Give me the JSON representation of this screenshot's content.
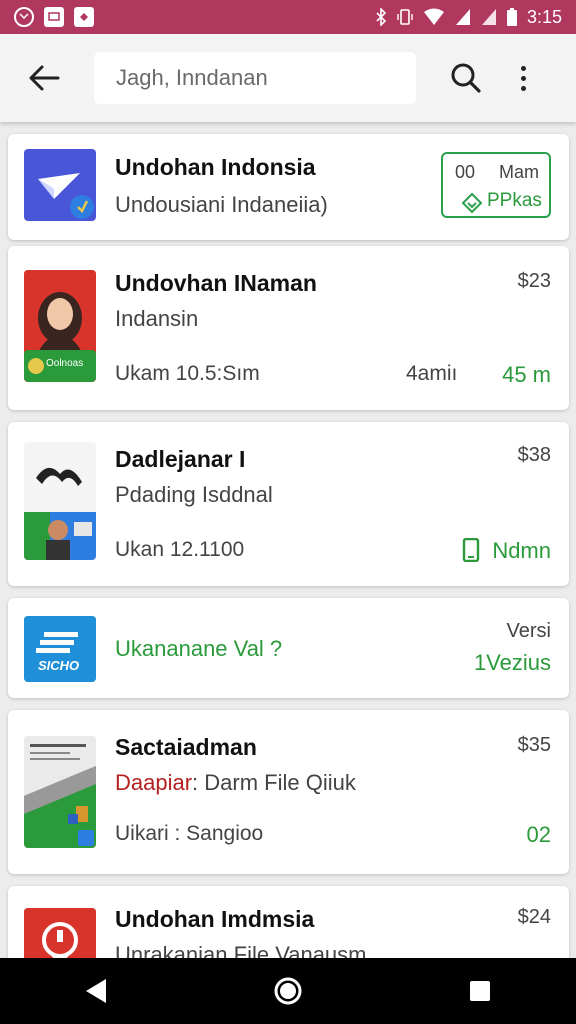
{
  "status_bar": {
    "time": "3:15",
    "left_icons": [
      "gmail-icon",
      "message-icon",
      "flipboard-icon"
    ],
    "right_icons": [
      "bluetooth-icon",
      "vibrate-icon",
      "wifi-icon",
      "signal-icon",
      "signal-icon",
      "battery-icon"
    ]
  },
  "app_bar": {
    "search_placeholder": "Jagh, Inndanan"
  },
  "items": [
    {
      "title": "Undohan Indonsia",
      "subtitle": "Undousiani Indaneiia)",
      "badge_top_left": "00",
      "badge_top_right": "Mam",
      "badge_bottom": "PPkas",
      "icon": "plane-icon"
    },
    {
      "title": "Undovhan INaman",
      "subtitle": "Indansin",
      "meta": "Ukam 10.5:Sım",
      "size": "4amiı",
      "right_green": "45 m",
      "price": "$23",
      "icon": "profile-photo-icon",
      "icon_badge": "Oolnoas"
    },
    {
      "title": "Dadlejanar I",
      "subtitle": "Pdading Isddnal",
      "meta": "Ukan 12.1100",
      "right_green": "Ndmn",
      "price": "$38",
      "icon": "swoosh-logo-icon"
    },
    {
      "subtitle": "Ukananane Val ?",
      "version_label": "Versi",
      "right_green": "1Vezius",
      "icon": "shield-logo-icon",
      "icon_text": "SICHO"
    },
    {
      "title": "Sactaiadman",
      "subtitle_prefix": "Daapiar",
      "subtitle_rest": ": Darm File Qiiuk",
      "meta": "Uikari : Sangioo",
      "right_green": "02",
      "price": "$35",
      "icon": "document-icon"
    },
    {
      "title": "Undohan Imdmsia",
      "subtitle": "Unrakanian File Vanausm",
      "price": "$24",
      "icon": "alert-icon"
    }
  ],
  "colors": {
    "status_bar": "#b0385e",
    "accent_green": "#2a9a3a",
    "card_bg": "#ffffff",
    "list_bg": "#ececec"
  }
}
